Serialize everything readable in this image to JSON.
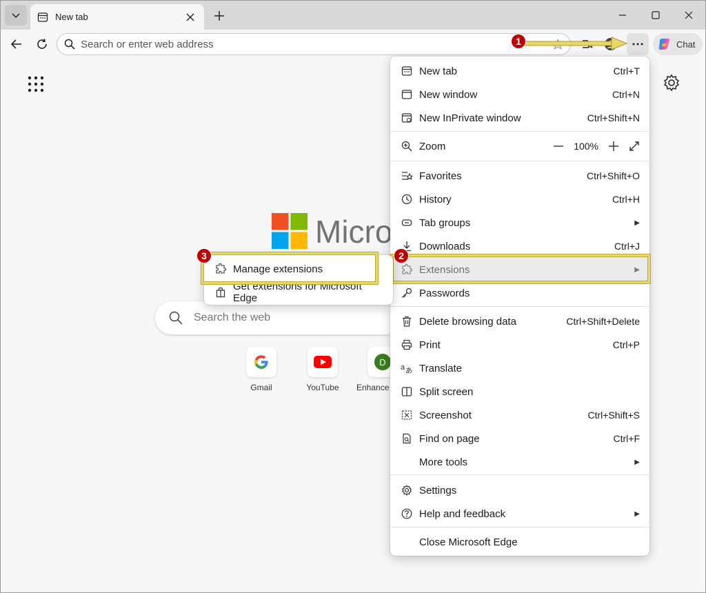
{
  "browser": {
    "tab_title": "New tab",
    "address_placeholder": "Search or enter web address",
    "chat_label": "Chat"
  },
  "page": {
    "logo_text": "Micros",
    "search_placeholder": "Search the web",
    "quicklinks": [
      {
        "label": "Gmail",
        "icon": "google-icon"
      },
      {
        "label": "YouTube",
        "icon": "youtube-icon"
      },
      {
        "label": "Enhance",
        "icon": "letter-d-icon",
        "letter": "D"
      }
    ]
  },
  "menu": {
    "items": [
      {
        "label": "New tab",
        "shortcut": "Ctrl+T",
        "icon": "new-tab-icon"
      },
      {
        "label": "New window",
        "shortcut": "Ctrl+N",
        "icon": "new-window-icon"
      },
      {
        "label": "New InPrivate window",
        "shortcut": "Ctrl+Shift+N",
        "icon": "inprivate-icon"
      },
      {
        "label": "Zoom",
        "icon": "zoom-icon",
        "zoom_value": "100%"
      },
      {
        "label": "Favorites",
        "shortcut": "Ctrl+Shift+O",
        "icon": "favorites-icon"
      },
      {
        "label": "History",
        "shortcut": "Ctrl+H",
        "icon": "history-icon"
      },
      {
        "label": "Tab groups",
        "icon": "tab-groups-icon",
        "submenu": true
      },
      {
        "label": "Downloads",
        "shortcut": "Ctrl+J",
        "icon": "downloads-icon"
      },
      {
        "label": "Extensions",
        "icon": "extensions-icon",
        "submenu": true
      },
      {
        "label": "Passwords",
        "icon": "key-icon"
      },
      {
        "label": "Delete browsing data",
        "shortcut": "Ctrl+Shift+Delete",
        "icon": "trash-icon"
      },
      {
        "label": "Print",
        "shortcut": "Ctrl+P",
        "icon": "print-icon"
      },
      {
        "label": "Translate",
        "icon": "translate-icon"
      },
      {
        "label": "Split screen",
        "icon": "split-screen-icon"
      },
      {
        "label": "Screenshot",
        "shortcut": "Ctrl+Shift+S",
        "icon": "screenshot-icon"
      },
      {
        "label": "Find on page",
        "shortcut": "Ctrl+F",
        "icon": "find-icon"
      },
      {
        "label": "More tools",
        "submenu": true
      },
      {
        "label": "Settings",
        "icon": "gear-icon"
      },
      {
        "label": "Help and feedback",
        "icon": "help-icon",
        "submenu": true
      },
      {
        "label": "Close Microsoft Edge"
      }
    ]
  },
  "submenu": {
    "items": [
      {
        "label": "Manage extensions",
        "icon": "extensions-icon"
      },
      {
        "label": "Get extensions for Microsoft Edge",
        "icon": "store-icon"
      }
    ]
  },
  "annotations": {
    "badges": [
      "1",
      "2",
      "3"
    ],
    "highlight_color": "#e8d86a",
    "badge_color": "#c00000"
  }
}
